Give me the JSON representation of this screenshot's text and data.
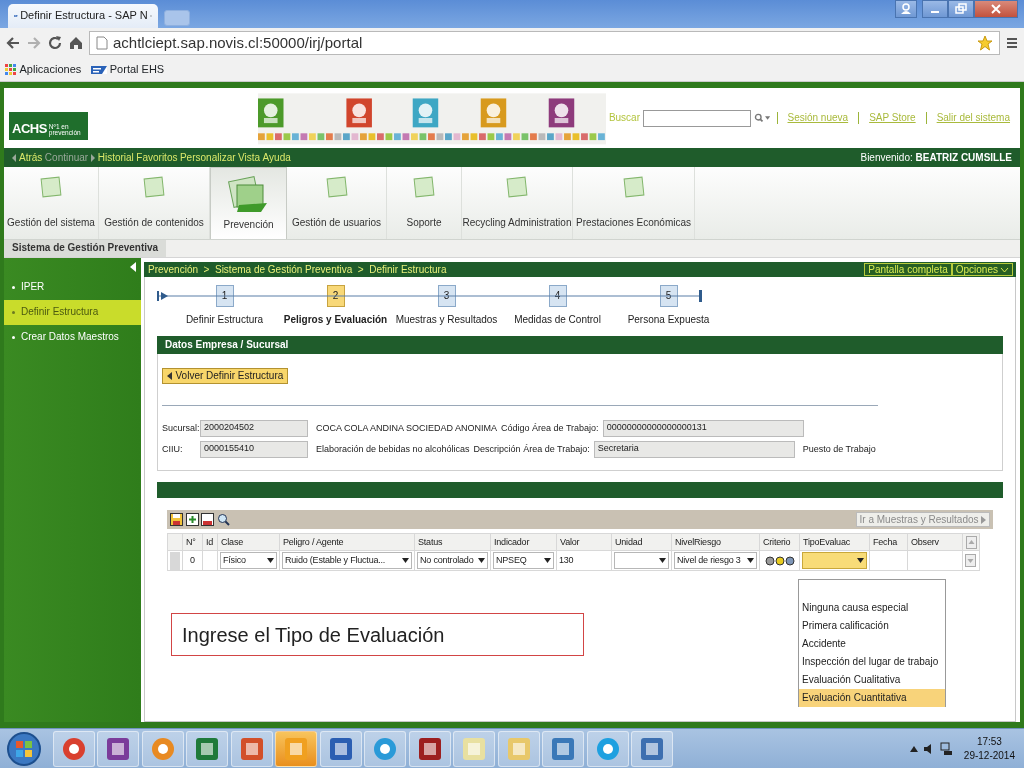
{
  "browser": {
    "tab_title": "Definir Estructura - SAP N",
    "url": "achtlciept.sap.novis.cl:50000/irj/portal",
    "bookmarks": [
      "Aplicaciones",
      "Portal EHS"
    ]
  },
  "header": {
    "logo": "ACHS",
    "tagline": "Nº1 en prevención",
    "search_label": "Buscar",
    "links": [
      "Sesión nueva",
      "SAP Store",
      "Salir del sistema"
    ]
  },
  "nav": {
    "items": [
      {
        "label": "Atrás",
        "disabled": false
      },
      {
        "label": "Continuar",
        "disabled": true
      },
      {
        "label": "Historial",
        "disabled": false
      },
      {
        "label": "Favoritos",
        "disabled": false
      },
      {
        "label": "Personalizar",
        "disabled": false
      },
      {
        "label": "Vista",
        "disabled": false
      },
      {
        "label": "Ayuda",
        "disabled": false
      }
    ],
    "welcome": "Bienvenido: **BEATRIZ CUMSILLE**"
  },
  "top_tabs": [
    {
      "label": "Gestión del sistema",
      "selected": false
    },
    {
      "label": "Gestión de contenidos",
      "selected": false
    },
    {
      "label": "Prevención",
      "selected": true
    },
    {
      "label": "Gestión de usuarios",
      "selected": false
    },
    {
      "label": "Soporte",
      "selected": false
    },
    {
      "label": "Recycling Administration",
      "selected": false
    },
    {
      "label": "Prestaciones Económicas",
      "selected": false
    }
  ],
  "sub_tab": "Sistema de Gestión Preventiva",
  "sidebar": {
    "items": [
      {
        "label": "IPER",
        "selected": false
      },
      {
        "label": "Definir Estructura",
        "selected": true
      },
      {
        "label": "Crear Datos Maestros",
        "selected": false
      }
    ]
  },
  "breadcrumb": "Prevención  >  Sistema de Gestión Preventiva  >  Definir Estructura",
  "page_buttons": [
    "Pantalla completa",
    "Opciones"
  ],
  "wizard": {
    "steps": [
      {
        "number": "1",
        "label": "Definir Estructura",
        "selected": false
      },
      {
        "number": "2",
        "label": "Peligros y Evaluación",
        "selected": true
      },
      {
        "number": "3",
        "label": "Muestras y Resultados",
        "selected": false
      },
      {
        "number": "4",
        "label": "Medidas de Control",
        "selected": false
      },
      {
        "number": "5",
        "label": "Persona Expuesta",
        "selected": false
      }
    ]
  },
  "company": {
    "title": "Datos Empresa / Sucursal",
    "back_button": "Volver Definir Estructura",
    "rows": [
      {
        "label": "Sucursal:",
        "value": "2000204502",
        "description": "COCA COLA ANDINA SOCIEDAD ANONIMA",
        "label_2": "Código Área de Trabajo:",
        "value_2": "00000000000000000131"
      },
      {
        "label": "CIIU:",
        "value": "0000155410",
        "description": "Elaboración de bebidas no alcohólicas",
        "label_2": "Descripción Área de Trabajo:",
        "value_2": "Secretaria",
        "extra": "Puesto de Trabajo"
      }
    ]
  },
  "grid": {
    "next_button": "Ir a Muestras y Resultados",
    "columns": [
      "N°",
      "Id",
      "Clase",
      "Peligro / Agente",
      "Status",
      "Indicador",
      "Valor",
      "Unidad",
      "NivelRiesgo",
      "Criterio",
      "TipoEvaluac",
      "Fecha",
      "Observ"
    ],
    "rows": [
      {
        "cells": [
          {
            "kind": "text",
            "value": "0"
          },
          {
            "kind": "text"
          },
          {
            "kind": "select",
            "value": "Físico",
            "focused": false
          },
          {
            "kind": "select",
            "value": "Ruido (Estable y Fluctua...",
            "focused": false
          },
          {
            "kind": "select",
            "value": "No controlado",
            "focused": false
          },
          {
            "kind": "select",
            "value": "NPSEQ",
            "focused": false
          },
          {
            "kind": "text",
            "value": "130"
          },
          {
            "kind": "select",
            "focused": false
          },
          {
            "kind": "select",
            "value": "Nivel de riesgo 3",
            "focused": false
          },
          {
            "kind": "lights",
            "lights": [
              {
                "color": "#9a9a9a"
              },
              {
                "color": "#e8cc20"
              },
              {
                "color": "#7f97b8"
              }
            ]
          },
          {
            "kind": "select",
            "focused": true
          },
          {
            "kind": "text"
          },
          {
            "kind": "text"
          }
        ]
      }
    ]
  },
  "dropdown": {
    "options": [
      {
        "label": "Ninguna causa especial",
        "selected": false
      },
      {
        "label": "Primera calificación",
        "selected": false
      },
      {
        "label": "Accidente",
        "selected": false
      },
      {
        "label": "Inspección del lugar de trabajo",
        "selected": false
      },
      {
        "label": "Evaluación Cualitativa",
        "selected": false
      },
      {
        "label": "Evaluación Cuantitativa",
        "selected": true
      }
    ]
  },
  "callout": "Ingrese el Tipo de Evaluación",
  "taskbar": {
    "time": "17:53",
    "date": "29-12-2014"
  }
}
